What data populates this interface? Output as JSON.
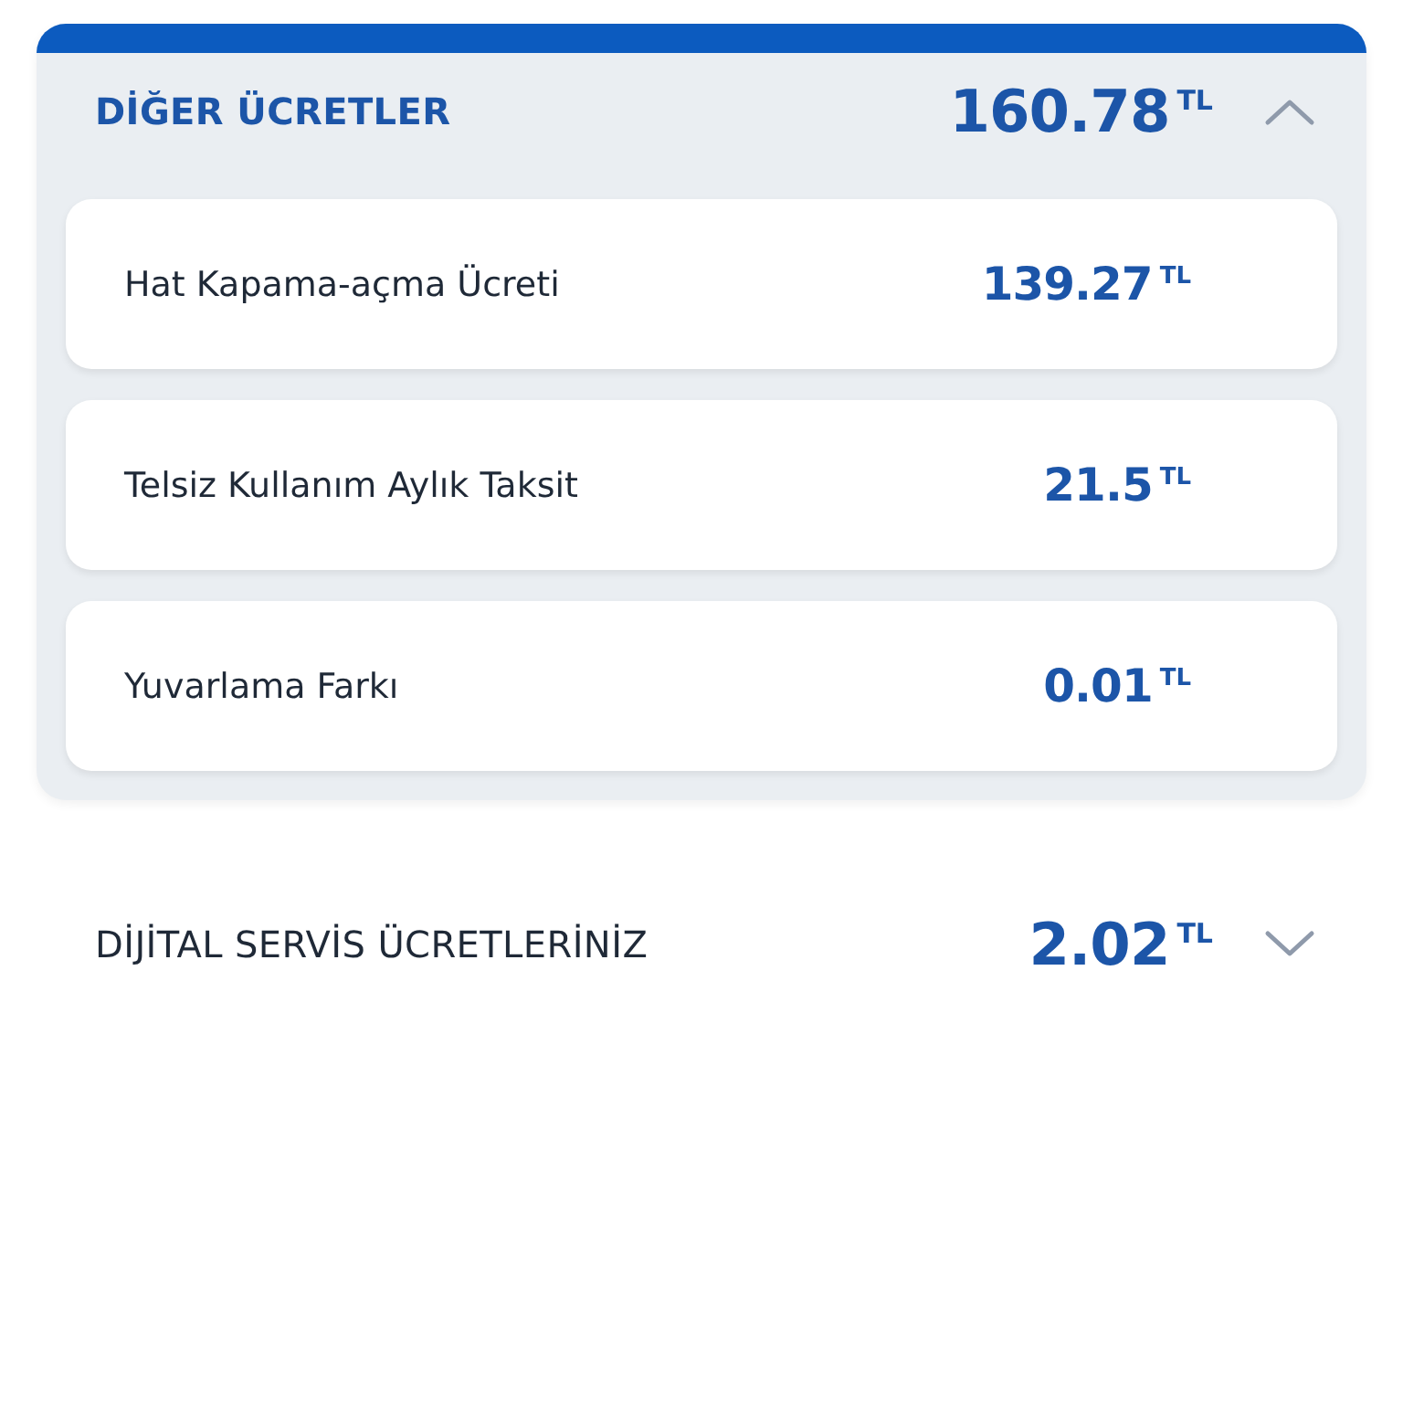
{
  "sections": [
    {
      "title": "DİĞER ÜCRETLER",
      "amount": "160.78",
      "currency": "TL",
      "expanded": true,
      "items": [
        {
          "label": "Hat Kapama-açma Ücreti",
          "amount": "139.27",
          "currency": "TL"
        },
        {
          "label": "Telsiz Kullanım Aylık Taksit",
          "amount": "21.5",
          "currency": "TL"
        },
        {
          "label": "Yuvarlama Farkı",
          "amount": "0.01",
          "currency": "TL"
        }
      ]
    },
    {
      "title": "DİJİTAL SERVİS ÜCRETLERİNİZ",
      "amount": "2.02",
      "currency": "TL",
      "expanded": false
    }
  ]
}
